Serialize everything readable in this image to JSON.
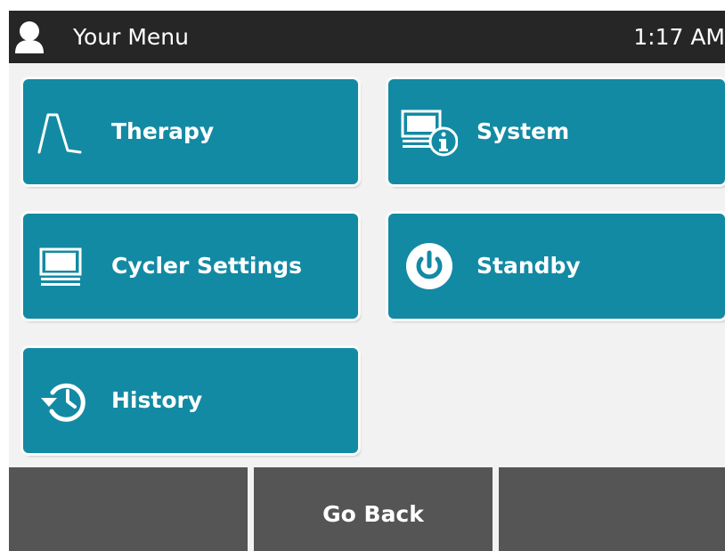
{
  "header": {
    "title": "Your Menu",
    "time": "1:17 AM",
    "user_icon": "user-icon"
  },
  "tiles": [
    {
      "label": "Therapy",
      "icon": "therapy-curve-icon"
    },
    {
      "label": "System",
      "icon": "system-info-icon"
    },
    {
      "label": "Cycler Settings",
      "icon": "cycler-icon"
    },
    {
      "label": "Standby",
      "icon": "power-icon"
    },
    {
      "label": "History",
      "icon": "history-icon"
    }
  ],
  "footer": {
    "left_label": "",
    "go_back_label": "Go Back",
    "right_label": ""
  },
  "colors": {
    "tile": "#138aa3",
    "header": "#262626",
    "footer_button": "#555556",
    "background": "#f2f2f2"
  }
}
